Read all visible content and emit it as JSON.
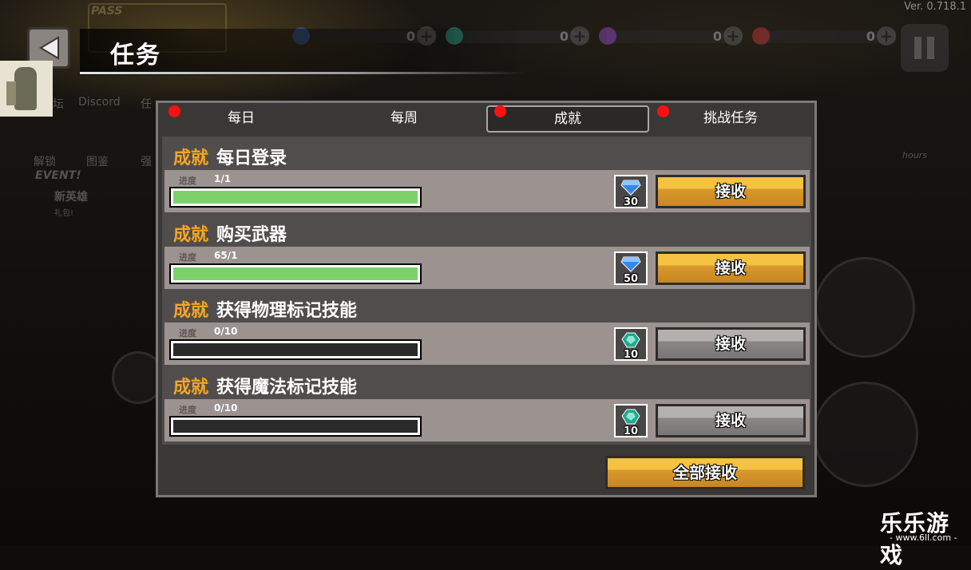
{
  "version": "Ver. 0.718.1",
  "header": {
    "title": "任务",
    "pass_label": "PASS"
  },
  "currencies": [
    {
      "name": "gem",
      "icon": "blue-gem-icon",
      "color": "#3a7bd5",
      "value": "0"
    },
    {
      "name": "energy",
      "icon": "green-orb-icon",
      "color": "#2bb5a0",
      "value": "0"
    },
    {
      "name": "crystal",
      "icon": "purple-crystal-icon",
      "color": "#9b4dd1",
      "value": "0"
    },
    {
      "name": "token",
      "icon": "red-token-icon",
      "color": "#d13a3a",
      "value": "0"
    }
  ],
  "background_menu": {
    "forum": "坛",
    "discord": "Discord",
    "task_partial": "任",
    "unlock": "解锁",
    "codex": "图鉴",
    "strong_partial": "强",
    "event": "EVENT!",
    "new_hero": "新英雄",
    "gift": "礼包!",
    "hours": "hours"
  },
  "tabs": [
    {
      "label": "每日",
      "has_dot": true,
      "active": false
    },
    {
      "label": "每周",
      "has_dot": false,
      "active": false
    },
    {
      "label": "成就",
      "has_dot": true,
      "active": true
    },
    {
      "label": "挑战任务",
      "has_dot": true,
      "active": false
    }
  ],
  "quests": [
    {
      "category": "成就",
      "name": "每日登录",
      "progress_label": "进度",
      "progress_text": "1/1",
      "progress": 1.0,
      "reward_icon": "blue-gem-icon",
      "reward_count": "30",
      "claim_label": "接收",
      "claimable": true
    },
    {
      "category": "成就",
      "name": "购买武器",
      "progress_label": "进度",
      "progress_text": "65/1",
      "progress": 1.0,
      "reward_icon": "blue-gem-icon",
      "reward_count": "50",
      "claim_label": "接收",
      "claimable": true
    },
    {
      "category": "成就",
      "name": "获得物理标记技能",
      "progress_label": "进度",
      "progress_text": "0/10",
      "progress": 0.0,
      "reward_icon": "green-orb-icon",
      "reward_count": "10",
      "claim_label": "接收",
      "claimable": false
    },
    {
      "category": "成就",
      "name": "获得魔法标记技能",
      "progress_label": "进度",
      "progress_text": "0/10",
      "progress": 0.0,
      "reward_icon": "green-orb-icon",
      "reward_count": "10",
      "claim_label": "接收",
      "claimable": false
    }
  ],
  "claim_all_label": "全部接收",
  "watermark": {
    "name": "乐乐游戏",
    "url": "- www.6ll.com -"
  },
  "colors": {
    "accent_gold": "#f5a623",
    "progress_green": "#7bd26a",
    "alert_red": "#ff1010"
  }
}
